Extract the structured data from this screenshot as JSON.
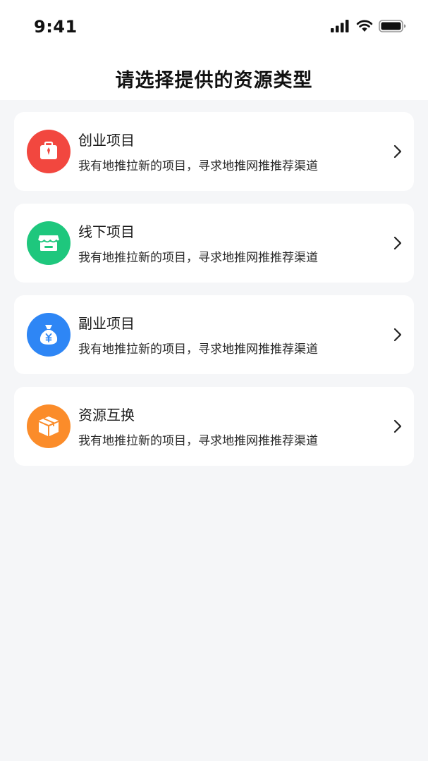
{
  "status_bar": {
    "time": "9:41",
    "signal_icon": "cellular-signal-icon",
    "wifi_icon": "wifi-icon",
    "battery_icon": "battery-icon"
  },
  "header": {
    "title": "请选择提供的资源类型"
  },
  "items": [
    {
      "title": "创业项目",
      "description": "我有地推拉新的项目，寻求地推网推推荐渠道",
      "icon": "briefcase-icon",
      "icon_color": "#f2473f"
    },
    {
      "title": "线下项目",
      "description": "我有地推拉新的项目，寻求地推网推推荐渠道",
      "icon": "store-icon",
      "icon_color": "#1ec77d"
    },
    {
      "title": "副业项目",
      "description": "我有地推拉新的项目，寻求地推网推推荐渠道",
      "icon": "money-bag-icon",
      "icon_color": "#2e86f5"
    },
    {
      "title": "资源互换",
      "description": "我有地推拉新的项目，寻求地推网推推荐渠道",
      "icon": "package-box-icon",
      "icon_color": "#fb8c2a"
    }
  ],
  "colors": {
    "background": "#f5f6f8",
    "card": "#ffffff",
    "text_primary": "#1a1a1a"
  }
}
